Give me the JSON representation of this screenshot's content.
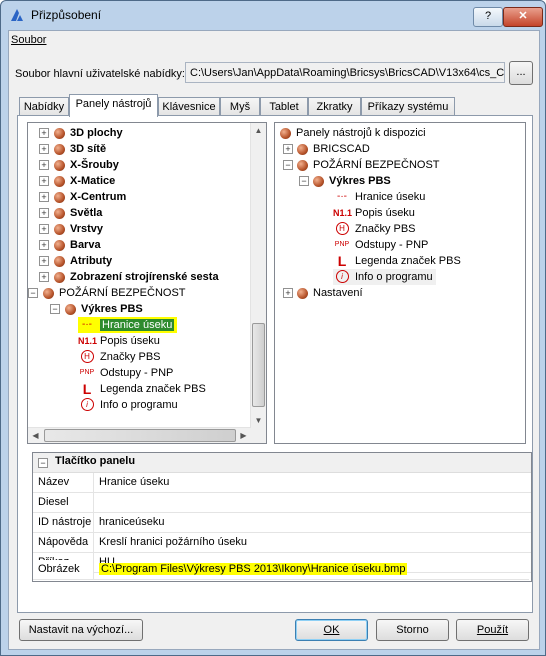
{
  "window": {
    "title": "Přizpůsobení",
    "help_label": "?",
    "close_label": "✕"
  },
  "menu": {
    "soubor": "Soubor"
  },
  "main_menu": {
    "label": "Soubor hlavní uživatelské nabídky:",
    "path": "C:\\Users\\Jan\\AppData\\Roaming\\Bricsys\\BricsCAD\\V13x64\\cs_CZ",
    "browse_label": "..."
  },
  "tabs": [
    "Nabídky",
    "Panely nástrojů",
    "Klávesnice",
    "Myš",
    "Tablet",
    "Zkratky",
    "Příkazy systému"
  ],
  "active_tab": "Panely nástrojů",
  "left_tree": {
    "items": [
      {
        "label": "3D plochy",
        "bold": true
      },
      {
        "label": "3D sítě",
        "bold": true
      },
      {
        "label": "X-Šrouby",
        "bold": true
      },
      {
        "label": "X-Matice",
        "bold": true
      },
      {
        "label": "X-Centrum",
        "bold": true
      },
      {
        "label": "Světla",
        "bold": true
      },
      {
        "label": "Vrstvy",
        "bold": true
      },
      {
        "label": "Barva",
        "bold": true
      },
      {
        "label": "Atributy",
        "bold": true
      },
      {
        "label": "Zobrazení strojírenské sesta",
        "bold": true
      },
      {
        "label": "POŽÁRNÍ BEZPEČNOST",
        "bold": false
      },
      {
        "label": "Výkres PBS",
        "bold": true
      },
      {
        "label": "Hranice úseku",
        "icon": "-·-"
      },
      {
        "label": "Popis úseku",
        "icon": "N1.1"
      },
      {
        "label": "Značky PBS",
        "icon": "H"
      },
      {
        "label": "Odstupy - PNP",
        "icon": "PNP"
      },
      {
        "label": "Legenda značek PBS",
        "icon": "L"
      },
      {
        "label": "Info o programu",
        "icon": "i"
      }
    ]
  },
  "right_tree": {
    "root": "Panely nástrojů k dispozici",
    "items": [
      {
        "label": "BRICSCAD"
      },
      {
        "label": "POŽÁRNÍ BEZPEČNOST"
      },
      {
        "label": "Výkres PBS",
        "bold": true
      },
      {
        "label": "Hranice úseku",
        "icon": "-·-"
      },
      {
        "label": "Popis úseku",
        "icon": "N1.1"
      },
      {
        "label": "Značky PBS",
        "icon": "H"
      },
      {
        "label": "Odstupy - PNP",
        "icon": "PNP"
      },
      {
        "label": "Legenda značek PBS",
        "icon": "L"
      },
      {
        "label": "Info o programu",
        "icon": "i"
      },
      {
        "label": "Nastavení"
      }
    ]
  },
  "properties": {
    "header": "Tlačítko panelu",
    "rows": [
      {
        "key": "Název",
        "value": "Hranice úseku"
      },
      {
        "key": "Diesel",
        "value": ""
      },
      {
        "key": "ID nástroje",
        "value": "hraniceúseku"
      },
      {
        "key": "Nápověda",
        "value": "Kreslí hranici požárního úseku"
      },
      {
        "key": "Příkaz",
        "value": "HU"
      },
      {
        "key": "Obrázek",
        "value": "C:\\Program Files\\Výkresy PBS 2013\\Ikony\\Hranice úseku.bmp"
      }
    ]
  },
  "buttons": {
    "reset": "Nastavit na výchozí...",
    "ok": "OK",
    "cancel": "Storno",
    "apply": "Použít"
  },
  "colors": {
    "highlight": "#ffff00",
    "icon_red": "#cc0000"
  }
}
